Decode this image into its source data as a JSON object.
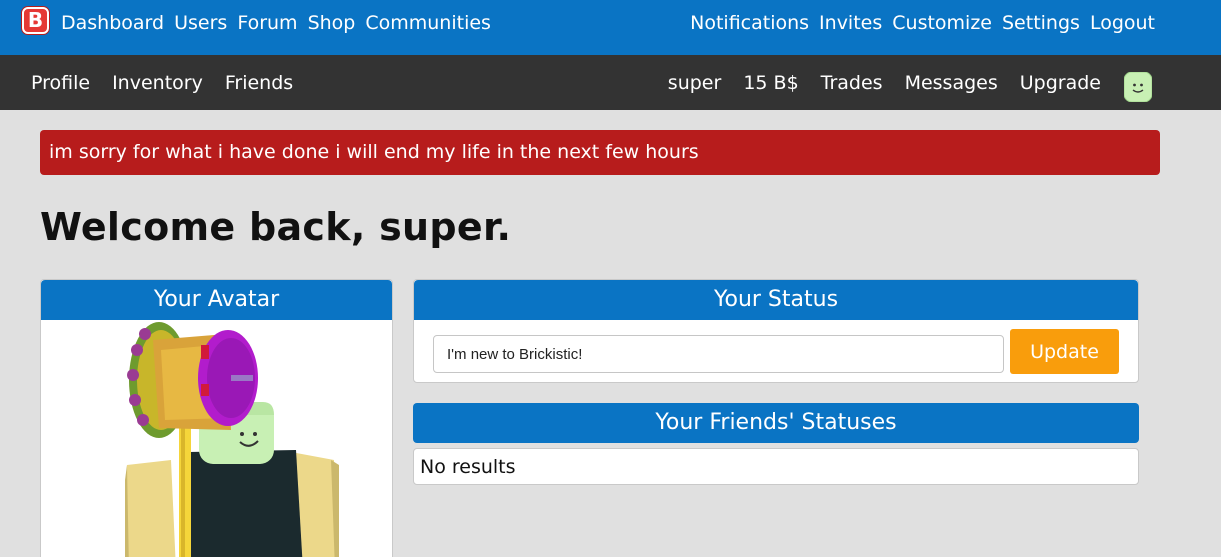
{
  "topnav": {
    "logo_letter": "B",
    "left": [
      "Dashboard",
      "Users",
      "Forum",
      "Shop",
      "Communities"
    ],
    "right": [
      "Notifications",
      "Invites",
      "Customize",
      "Settings",
      "Logout"
    ]
  },
  "subnav": {
    "left": [
      "Profile",
      "Inventory",
      "Friends"
    ],
    "username": "super",
    "currency": "15 B$",
    "right": [
      "Trades",
      "Messages",
      "Upgrade"
    ]
  },
  "alert": {
    "text": "im sorry for what i have done i will end my life in the next few hours"
  },
  "welcome": {
    "title": "Welcome back, super."
  },
  "avatar_panel": {
    "title": "Your Avatar"
  },
  "status_panel": {
    "title": "Your Status",
    "input_value": "I'm new to Brickistic!",
    "update_label": "Update"
  },
  "friends_panel": {
    "title": "Your Friends' Statuses",
    "empty_text": "No results"
  },
  "colors": {
    "primary": "#0a74c4",
    "subbar": "#333333",
    "alert": "#b71c1c",
    "button": "#f99d0c",
    "background": "#e0e0e0"
  }
}
